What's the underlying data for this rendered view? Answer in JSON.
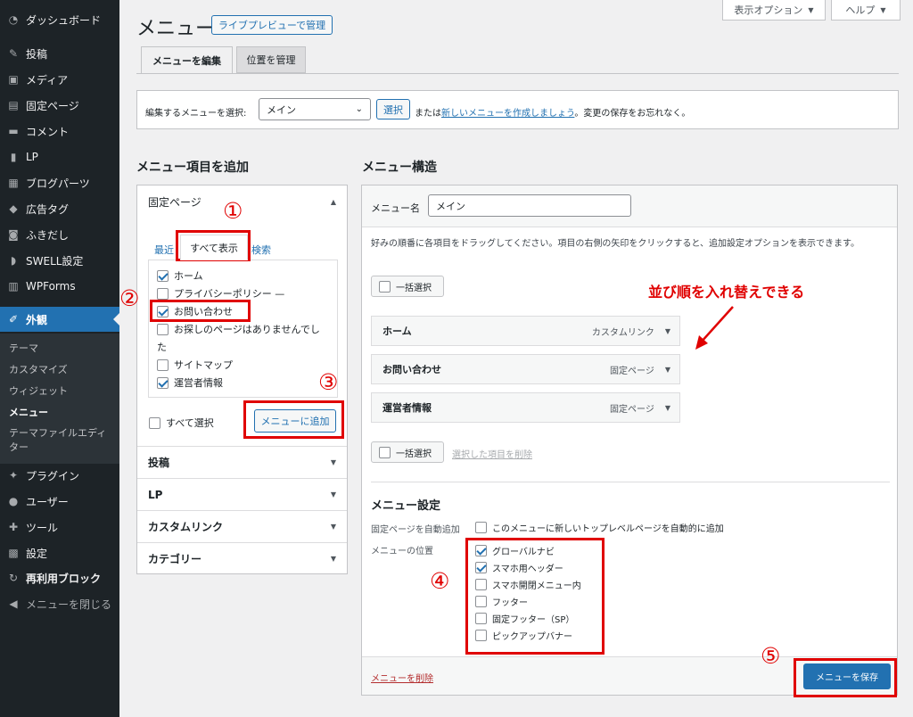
{
  "sidebar": {
    "dashboard": "ダッシュボード",
    "posts": "投稿",
    "media": "メディア",
    "pages": "固定ページ",
    "comments": "コメント",
    "lp": "LP",
    "blog_parts": "ブログパーツ",
    "ad_tags": "広告タグ",
    "fukidashi": "ふきだし",
    "swell": "SWELL設定",
    "wpforms": "WPForms",
    "appearance": "外観",
    "sub": {
      "theme": "テーマ",
      "customize": "カスタマイズ",
      "widgets": "ウィジェット",
      "menus": "メニュー",
      "theme_editor_1": "テーマファイルエディ",
      "theme_editor_2": "ター"
    },
    "plugins": "プラグイン",
    "users": "ユーザー",
    "tools": "ツール",
    "settings": "設定",
    "reusable": "再利用ブロック",
    "collapse": "メニューを閉じる",
    "icons": [
      "dashboard-icon",
      "pin-icon",
      "media-icon",
      "page-icon",
      "comment-icon",
      "lp-icon",
      "blog-parts-icon",
      "tag-icon",
      "speech-icon",
      "swell-icon",
      "form-icon",
      "brush-icon",
      "plugin-icon",
      "user-icon",
      "wrench-icon",
      "settings-icon",
      "reuse-icon",
      "collapse-icon"
    ]
  },
  "header": {
    "title": "メニュー",
    "live_preview": "ライブプレビューで管理",
    "screen_options": "表示オプション",
    "help": "ヘルプ"
  },
  "tabs": {
    "edit": "メニューを編集",
    "locations": "位置を管理"
  },
  "select_bar": {
    "label": "編集するメニューを選択:",
    "value": "メイン",
    "select_btn": "選択",
    "or": "または",
    "create_link": "新しいメニューを作成しましょう",
    "suffix": "。変更の保存をお忘れなく。"
  },
  "add_items": {
    "heading": "メニュー項目を追加",
    "pages_title": "固定ページ",
    "tabs": {
      "recent": "最近",
      "all": "すべて表示",
      "search": "検索"
    },
    "pages": [
      {
        "label": "ホーム",
        "checked": true
      },
      {
        "label": "プライバシーポリシー —",
        "checked": false
      },
      {
        "label": "お問い合わせ",
        "checked": true
      },
      {
        "label": "お探しのページはありませんでし",
        "label2": "た",
        "checked": false
      },
      {
        "label": "サイトマップ",
        "checked": false
      },
      {
        "label": "運営者情報",
        "checked": true
      }
    ],
    "select_all": "すべて選択",
    "add_button": "メニューに追加",
    "accordions": [
      "投稿",
      "LP",
      "カスタムリンク",
      "カテゴリー"
    ]
  },
  "structure": {
    "heading": "メニュー構造",
    "name_label": "メニュー名",
    "name_value": "メイン",
    "instructions": "好みの順番に各項目をドラッグしてください。項目の右側の矢印をクリックすると、追加設定オプションを表示できます。",
    "bulk_select": "一括選択",
    "items": [
      {
        "title": "ホーム",
        "type": "カスタムリンク"
      },
      {
        "title": "お問い合わせ",
        "type": "固定ページ"
      },
      {
        "title": "運営者情報",
        "type": "固定ページ"
      }
    ],
    "remove_selected": "選択した項目を削除",
    "settings_heading": "メニュー設定",
    "auto_add_label": "固定ページを自動追加",
    "auto_add_text": "このメニューに新しいトップレベルページを自動的に追加",
    "locations_label": "メニューの位置",
    "locations": [
      {
        "label": "グローバルナビ",
        "checked": true
      },
      {
        "label": "スマホ用ヘッダー",
        "checked": true
      },
      {
        "label": "スマホ開閉メニュー内",
        "checked": false
      },
      {
        "label": "フッター",
        "checked": false
      },
      {
        "label": "固定フッター（SP）",
        "checked": false
      },
      {
        "label": "ピックアップバナー",
        "checked": false
      }
    ],
    "delete_menu": "メニューを削除",
    "save": "メニューを保存"
  },
  "annotations": {
    "n1": "①",
    "n2": "②",
    "n3": "③",
    "n4": "④",
    "n5": "⑤",
    "reorder": "並び順を入れ替えできる",
    "accent": "#e00000"
  }
}
